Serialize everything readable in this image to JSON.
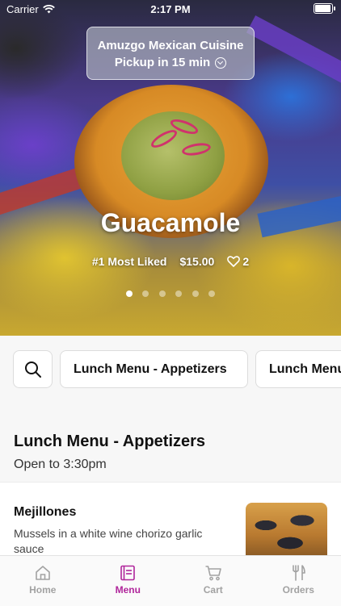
{
  "status_bar": {
    "carrier": "Carrier",
    "time": "2:17 PM"
  },
  "store": {
    "name": "Amuzgo Mexican Cuisine",
    "pickup": "Pickup in 15 min"
  },
  "hero": {
    "title": "Guacamole",
    "badge": "#1 Most Liked",
    "price": "$15.00",
    "likes": "2",
    "carousel": {
      "count": 6,
      "active_index": 0
    }
  },
  "categories": {
    "items": [
      "Lunch Menu - Appetizers",
      "Lunch Menu"
    ]
  },
  "section": {
    "title": "Lunch Menu - Appetizers",
    "hours": "Open to 3:30pm"
  },
  "menu_items": [
    {
      "name": "Mejillones",
      "description": "Mussels in a white wine chorizo garlic sauce"
    }
  ],
  "tabs": [
    {
      "label": "Home",
      "icon": "home-icon"
    },
    {
      "label": "Menu",
      "icon": "menu-book-icon"
    },
    {
      "label": "Cart",
      "icon": "cart-icon"
    },
    {
      "label": "Orders",
      "icon": "utensils-icon"
    }
  ],
  "colors": {
    "accent": "#b0259b",
    "tab_inactive": "#a2a2a2"
  }
}
